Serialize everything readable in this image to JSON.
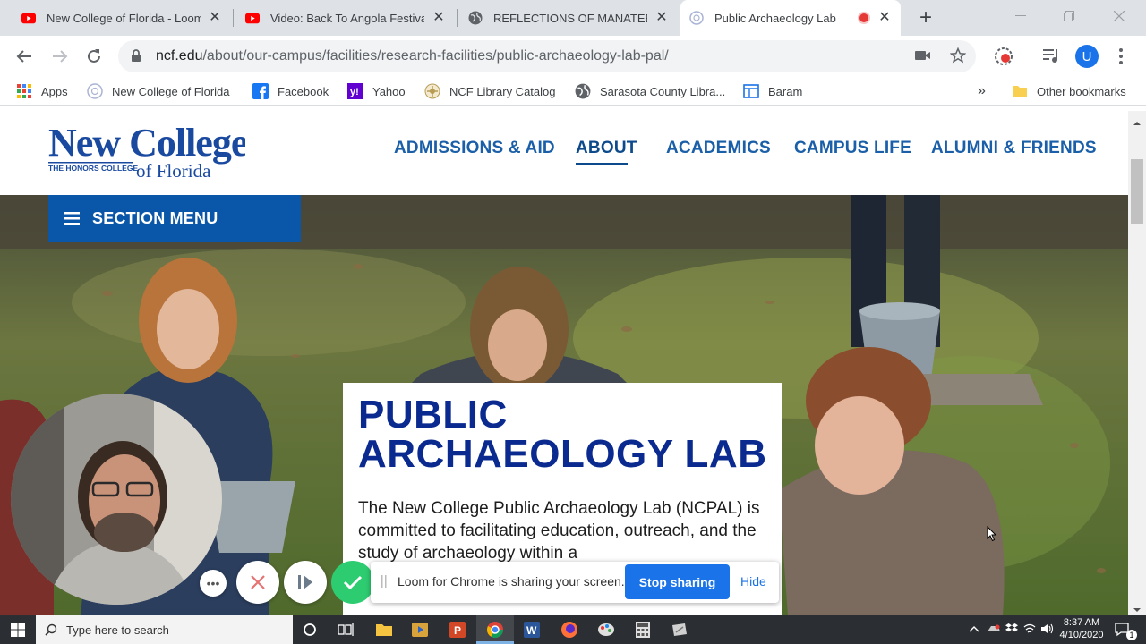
{
  "browser": {
    "tabs": [
      {
        "title": "New College of Florida - Loom",
        "favicon": "youtube-icon"
      },
      {
        "title": "Video: Back To Angola Festival",
        "favicon": "youtube-icon"
      },
      {
        "title": "REFLECTIONS OF MANATEE",
        "favicon": "globe-icon"
      },
      {
        "title": "Public Archaeology Lab",
        "favicon": "ncf-seal-icon",
        "active": true,
        "recording": true
      }
    ],
    "url_host": "ncf.edu",
    "url_path": "/about/our-campus/facilities/research-facilities/public-archaeology-lab-pal/",
    "profile_initial": "U",
    "bookmarks": [
      {
        "label": "Apps",
        "icon": "apps-grid-icon"
      },
      {
        "label": "New College of Florida",
        "icon": "ncf-seal-icon"
      },
      {
        "label": "Facebook",
        "icon": "facebook-icon"
      },
      {
        "label": "Yahoo",
        "icon": "yahoo-icon"
      },
      {
        "label": "NCF Library Catalog",
        "icon": "library-icon"
      },
      {
        "label": "Sarasota County Libra...",
        "icon": "globe-icon"
      },
      {
        "label": "Baram",
        "icon": "page-icon"
      }
    ],
    "bookmarks_more": "»",
    "other_bookmarks": "Other bookmarks"
  },
  "site": {
    "logo_line1": "New College",
    "logo_tagline": "THE HONORS COLLEGE",
    "logo_line2": "of Florida",
    "nav": [
      "ADMISSIONS & AID",
      "ABOUT",
      "ACADEMICS",
      "CAMPUS LIFE",
      "ALUMNI & FRIENDS"
    ],
    "nav_active": "ABOUT",
    "section_menu": "SECTION MENU",
    "page_title": "PUBLIC ARCHAEOLOGY LAB",
    "intro": "The New College Public Archaeology Lab (NCPAL) is committed to facilitating education, outreach, and the study of archaeology within a"
  },
  "loom": {
    "sharing_text": "Loom for Chrome is sharing your screen.",
    "stop_label": "Stop sharing",
    "hide_label": "Hide"
  },
  "taskbar": {
    "search_placeholder": "Type here to search",
    "time": "8:37 AM",
    "date": "4/10/2020",
    "notification_count": "1"
  },
  "colors": {
    "ncf_blue": "#0a56a8",
    "title_navy": "#0a2a8f",
    "chrome_blue": "#1a73e8",
    "loom_green": "#2ecc71"
  }
}
